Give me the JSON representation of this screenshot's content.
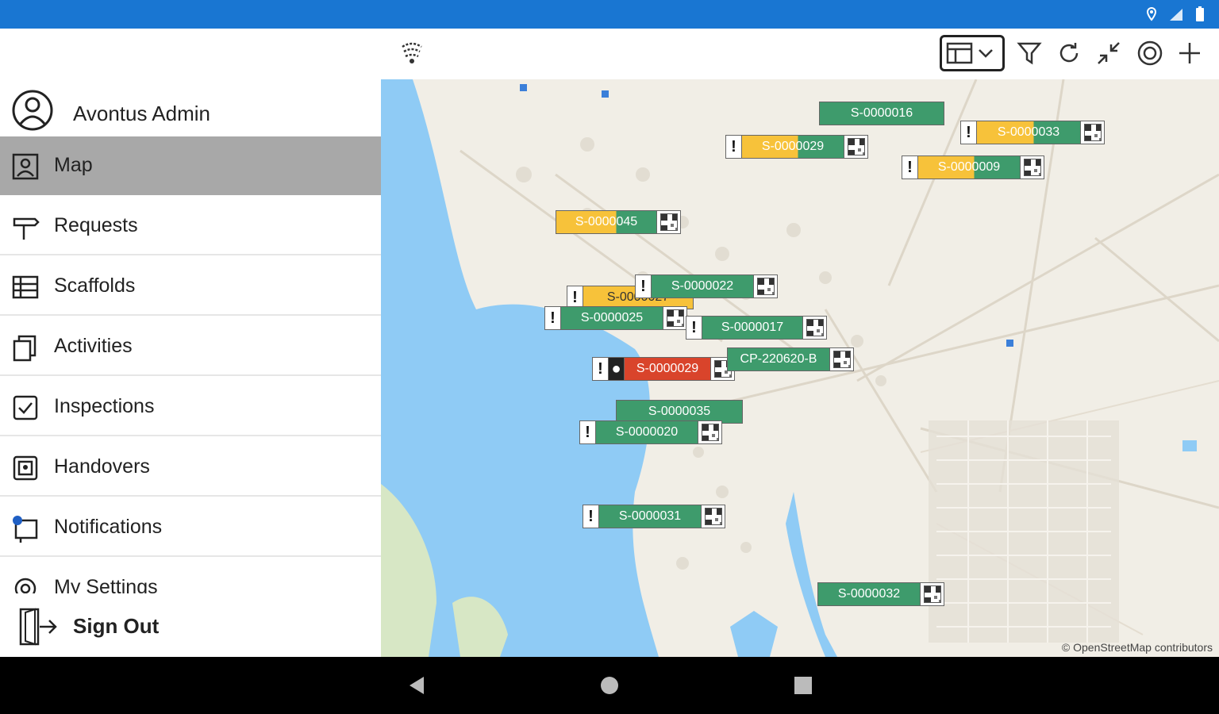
{
  "colors": {
    "status_bar": "#1976d2",
    "marker_green": "#3e9b6c",
    "marker_yellow": "#f7c23a",
    "marker_red": "#d9442b",
    "water": "#8fcbf5",
    "map_land": "#f1eee6"
  },
  "user": {
    "name": "Avontus Admin"
  },
  "menu": {
    "items": [
      {
        "label": "Map",
        "icon": "map-pin-icon",
        "active": true
      },
      {
        "label": "Requests",
        "icon": "signpost-icon"
      },
      {
        "label": "Scaffolds",
        "icon": "scaffold-icon"
      },
      {
        "label": "Activities",
        "icon": "activities-icon"
      },
      {
        "label": "Inspections",
        "icon": "checkbox-icon"
      },
      {
        "label": "Handovers",
        "icon": "handover-icon"
      },
      {
        "label": "Notifications",
        "icon": "bell-icon"
      },
      {
        "label": "My Settings",
        "icon": "settings-icon"
      }
    ],
    "sign_out": "Sign Out"
  },
  "toolbar": {
    "icons": [
      "layer-icon",
      "view-select-icon",
      "filter-icon",
      "refresh-icon",
      "collapse-icon",
      "location-icon",
      "add-icon"
    ]
  },
  "map": {
    "attribution": "© OpenStreetMap contributors",
    "markers": [
      {
        "label": "S-0000016",
        "color": "green",
        "alert": false
      },
      {
        "label": "S-0000029",
        "color": "yellow-green",
        "alert": true
      },
      {
        "label": "S-0000033",
        "color": "yellow-green",
        "alert": true
      },
      {
        "label": "S-0000009",
        "color": "yellow-green",
        "alert": true
      },
      {
        "label": "S-0000045",
        "color": "yellow-green",
        "alert": false
      },
      {
        "label": "S-0000022",
        "color": "green",
        "alert": true
      },
      {
        "label": "S-0000027",
        "color": "yellow",
        "alert": true
      },
      {
        "label": "S-0000025",
        "color": "green",
        "alert": true
      },
      {
        "label": "S-0000017",
        "color": "green",
        "alert": true
      },
      {
        "label": "S-0000029",
        "color": "red",
        "alert": true
      },
      {
        "label": "CP-220620-B",
        "color": "green",
        "alert": false
      },
      {
        "label": "S-0000035",
        "color": "green",
        "alert": false
      },
      {
        "label": "S-0000020",
        "color": "green",
        "alert": true
      },
      {
        "label": "S-0000031",
        "color": "green",
        "alert": true
      },
      {
        "label": "S-0000032",
        "color": "green",
        "alert": false
      }
    ]
  }
}
